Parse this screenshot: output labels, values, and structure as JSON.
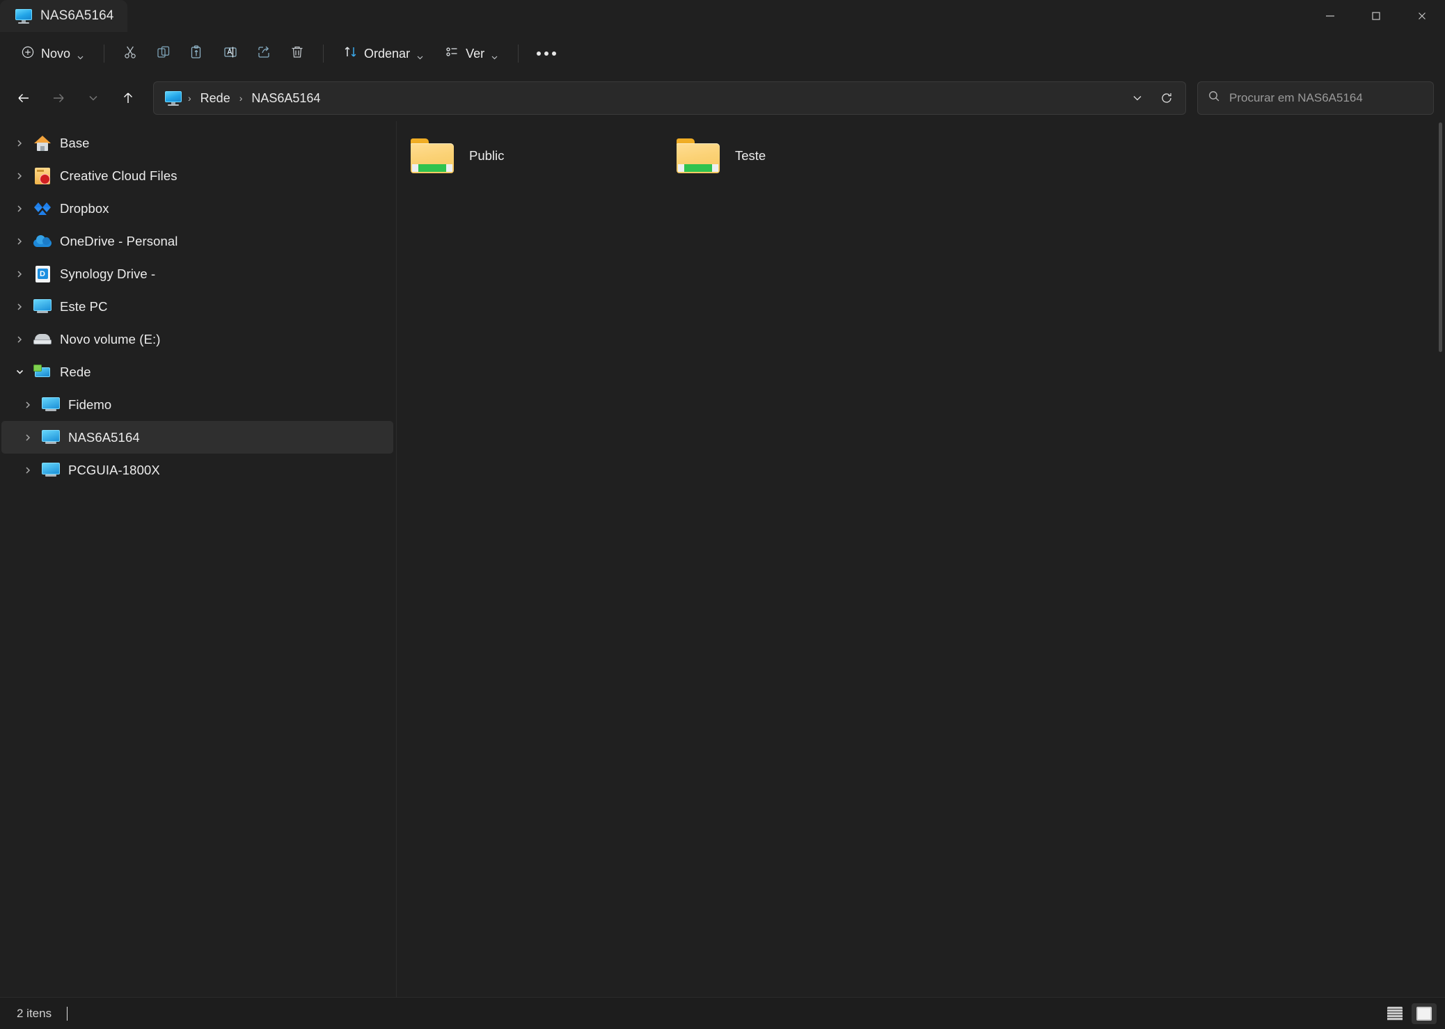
{
  "window": {
    "title": "NAS6A5164",
    "title_icon": "monitor-icon",
    "controls": {
      "minimize": "Minimizar",
      "maximize": "Maximizar",
      "close": "Fechar"
    }
  },
  "toolbar": {
    "new_label": "Novo",
    "new_icon": "plus-circle-icon",
    "cut_icon": "scissors-icon",
    "copy_icon": "copy-icon",
    "paste_icon": "paste-icon",
    "rename_icon": "rename-icon",
    "share_icon": "share-icon",
    "delete_icon": "trash-icon",
    "sort_label": "Ordenar",
    "sort_icon": "sort-arrows-icon",
    "view_label": "Ver",
    "view_icon": "view-list-icon",
    "more_icon": "ellipsis-icon"
  },
  "navigation": {
    "back_icon": "arrow-left-icon",
    "forward_icon": "arrow-right-icon",
    "recent_icon": "chevron-down-icon",
    "up_icon": "arrow-up-icon",
    "history_icon": "chevron-down-icon",
    "refresh_icon": "refresh-icon"
  },
  "address": {
    "root_icon": "monitor-icon",
    "crumbs": [
      {
        "label": "Rede"
      },
      {
        "label": "NAS6A5164"
      }
    ],
    "separator": "›"
  },
  "search": {
    "icon": "search-icon",
    "placeholder": "Procurar em NAS6A5164",
    "value": ""
  },
  "sidebar": {
    "items": [
      {
        "label": "Base",
        "icon": "home-icon",
        "level": 1,
        "expanded": false,
        "selected": false
      },
      {
        "label": "Creative Cloud Files",
        "icon": "creative-cloud-icon",
        "level": 1,
        "expanded": false,
        "selected": false
      },
      {
        "label": "Dropbox",
        "icon": "dropbox-icon",
        "level": 1,
        "expanded": false,
        "selected": false
      },
      {
        "label": "OneDrive - Personal",
        "icon": "onedrive-icon",
        "level": 1,
        "expanded": false,
        "selected": false
      },
      {
        "label": "Synology Drive -",
        "icon": "synology-icon",
        "level": 1,
        "expanded": false,
        "selected": false
      },
      {
        "label": "Este PC",
        "icon": "this-pc-icon",
        "level": 1,
        "expanded": false,
        "selected": false
      },
      {
        "label": "Novo volume (E:)",
        "icon": "drive-icon",
        "level": 1,
        "expanded": false,
        "selected": false
      },
      {
        "label": "Rede",
        "icon": "network-icon",
        "level": 1,
        "expanded": true,
        "selected": false
      },
      {
        "label": "Fidemo",
        "icon": "computer-icon",
        "level": 2,
        "expanded": false,
        "selected": false
      },
      {
        "label": "NAS6A5164",
        "icon": "computer-icon",
        "level": 2,
        "expanded": false,
        "selected": true
      },
      {
        "label": "PCGUIA-1800X",
        "icon": "computer-icon",
        "level": 2,
        "expanded": false,
        "selected": false
      }
    ]
  },
  "main": {
    "items": [
      {
        "name": "Public",
        "icon": "shared-folder-icon"
      },
      {
        "name": "Teste",
        "icon": "shared-folder-icon"
      }
    ]
  },
  "status": {
    "item_count": "2 itens",
    "list_view_icon": "details-view-icon",
    "icons_view_icon": "large-icons-view-icon"
  },
  "colors": {
    "accent": "#2a8bf2",
    "window_bg": "#202020",
    "selection": "#2f2f2f",
    "folder": "#f7c85f",
    "share_band": "#2fc34f"
  }
}
